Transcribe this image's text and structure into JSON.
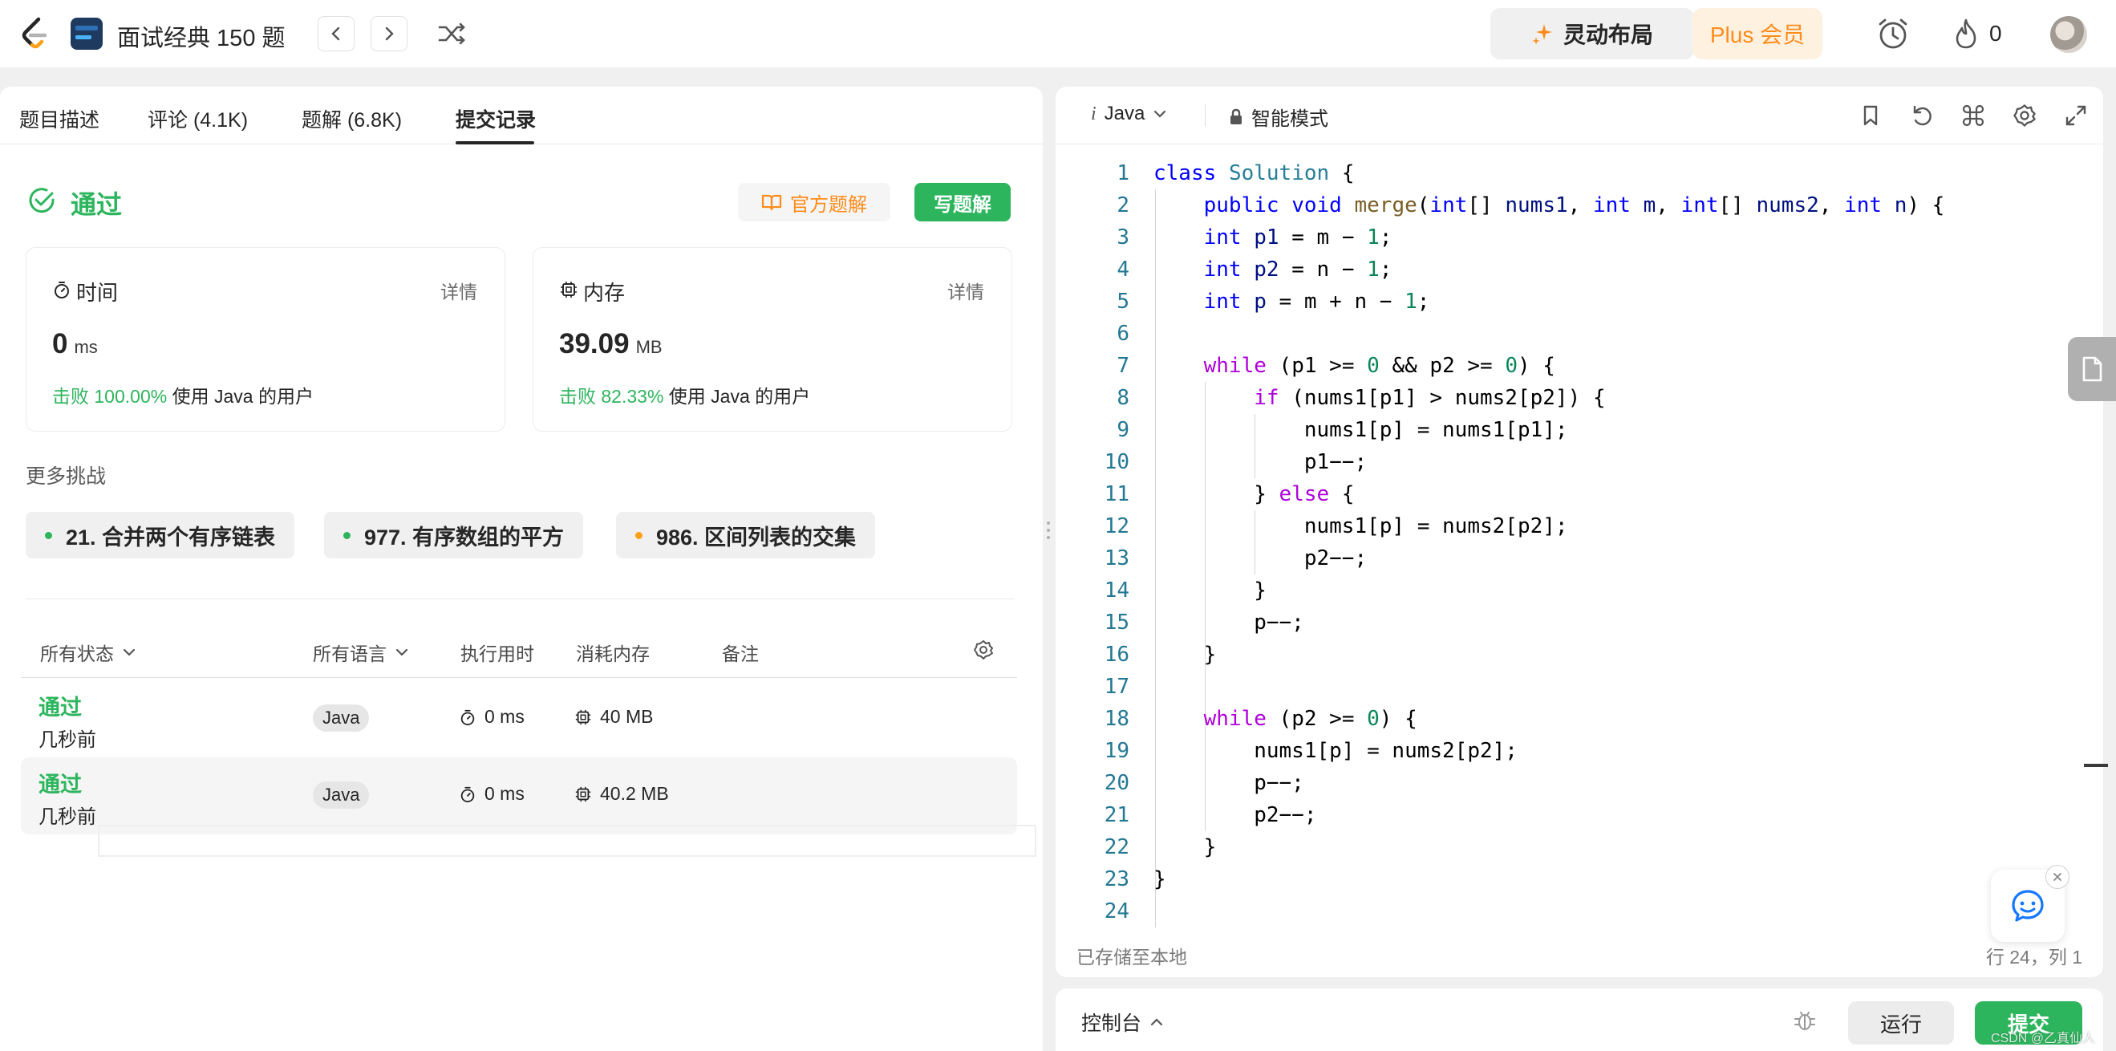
{
  "nav": {
    "title": "面试经典 150 题",
    "layout_label": "灵动布局",
    "plus_label": "Plus 会员",
    "fire_count": "0"
  },
  "tabs": [
    "题目描述",
    "评论 (4.1K)",
    "题解 (6.8K)",
    "提交记录"
  ],
  "result": {
    "status": "通过",
    "official_solution": "官方题解",
    "write_solution": "写题解",
    "time": {
      "label": "时间",
      "details": "详情",
      "value": "0",
      "unit": "ms",
      "beat": "击败 100.00%",
      "beat_suffix": "使用 Java 的用户"
    },
    "memory": {
      "label": "内存",
      "details": "详情",
      "value": "39.09",
      "unit": "MB",
      "beat": "击败 82.33%",
      "beat_suffix": "使用 Java 的用户"
    }
  },
  "more": {
    "title": "更多挑战",
    "items": [
      {
        "label": "21. 合并两个有序链表",
        "dot": "#2db55d"
      },
      {
        "label": "977. 有序数组的平方",
        "dot": "#2db55d"
      },
      {
        "label": "986. 区间列表的交集",
        "dot": "#ffa116"
      }
    ]
  },
  "table": {
    "filters": {
      "status": "所有状态",
      "language": "所有语言",
      "runtime": "执行用时",
      "memory": "消耗内存",
      "notes": "备注"
    },
    "rows": [
      {
        "status": "通过",
        "time": "几秒前",
        "lang": "Java",
        "runtime": "0 ms",
        "memory": "40 MB"
      },
      {
        "status": "通过",
        "time": "几秒前",
        "lang": "Java",
        "runtime": "0 ms",
        "memory": "40.2 MB"
      }
    ]
  },
  "editor": {
    "language": "Java",
    "language_prefix": "i",
    "mode": "智能模式",
    "saved": "已存储至本地",
    "position": "行 24，列 1",
    "line_numbers": [
      "1",
      "2",
      "3",
      "4",
      "5",
      "6",
      "7",
      "8",
      "9",
      "10",
      "11",
      "12",
      "13",
      "14",
      "15",
      "16",
      "17",
      "18",
      "19",
      "20",
      "21",
      "22",
      "23",
      "24"
    ]
  },
  "console": {
    "label": "控制台",
    "run": "运行",
    "submit": "提交"
  },
  "watermark": "CSDN @乙真仙人",
  "colors": {
    "accent_green": "#2db55d",
    "accent_orange": "#ff8c1a"
  }
}
